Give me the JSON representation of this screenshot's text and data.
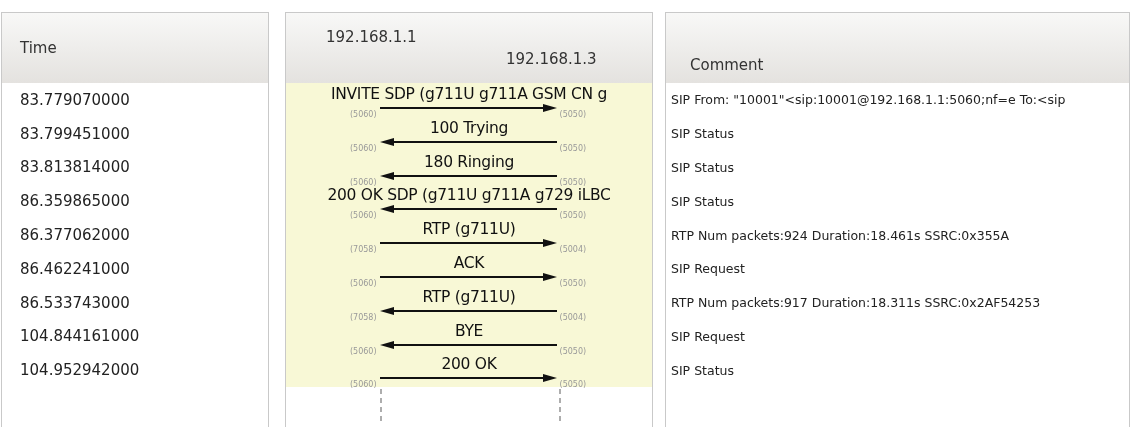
{
  "time_panel": {
    "header": "Time",
    "rows": [
      "83.779070000",
      "83.799451000",
      "83.813814000",
      "86.359865000",
      "86.377062000",
      "86.462241000",
      "86.533743000",
      "104.844161000",
      "104.952942000"
    ]
  },
  "flow_panel": {
    "hosts": [
      "192.168.1.1",
      "192.168.1.3"
    ],
    "messages": [
      {
        "label": "INVITE SDP (g711U g711A GSM CN g",
        "kind": "rightward",
        "left_port": "(5060)",
        "right_port": "(5050)"
      },
      {
        "label": "100 Trying",
        "kind": "leftward",
        "left_port": "(5060)",
        "right_port": "(5050)"
      },
      {
        "label": "180 Ringing",
        "kind": "leftward",
        "left_port": "(5060)",
        "right_port": "(5050)"
      },
      {
        "label": "200 OK SDP (g711U g711A g729 iLBC",
        "kind": "leftward",
        "left_port": "(5060)",
        "right_port": "(5050)"
      },
      {
        "label": "RTP (g711U)",
        "kind": "rightward",
        "left_port": "(7058)",
        "right_port": "(5004)"
      },
      {
        "label": "ACK",
        "kind": "rightward",
        "left_port": "(5060)",
        "right_port": "(5050)"
      },
      {
        "label": "RTP (g711U)",
        "kind": "leftward",
        "left_port": "(7058)",
        "right_port": "(5004)"
      },
      {
        "label": "BYE",
        "kind": "leftward",
        "left_port": "(5060)",
        "right_port": "(5050)"
      },
      {
        "label": "200 OK",
        "kind": "rightward",
        "left_port": "(5060)",
        "right_port": "(5050)"
      }
    ]
  },
  "comment_panel": {
    "header": "Comment",
    "rows": [
      "SIP From: \"10001\"<sip:10001@192.168.1.1:5060;nf=e To:<sip",
      "SIP Status",
      "SIP Status",
      "SIP Status",
      "RTP Num packets:924  Duration:18.461s SSRC:0x355A",
      "SIP Request",
      "RTP Num packets:917  Duration:18.311s SSRC:0x2AF54253",
      "SIP Request",
      "SIP Status"
    ]
  }
}
